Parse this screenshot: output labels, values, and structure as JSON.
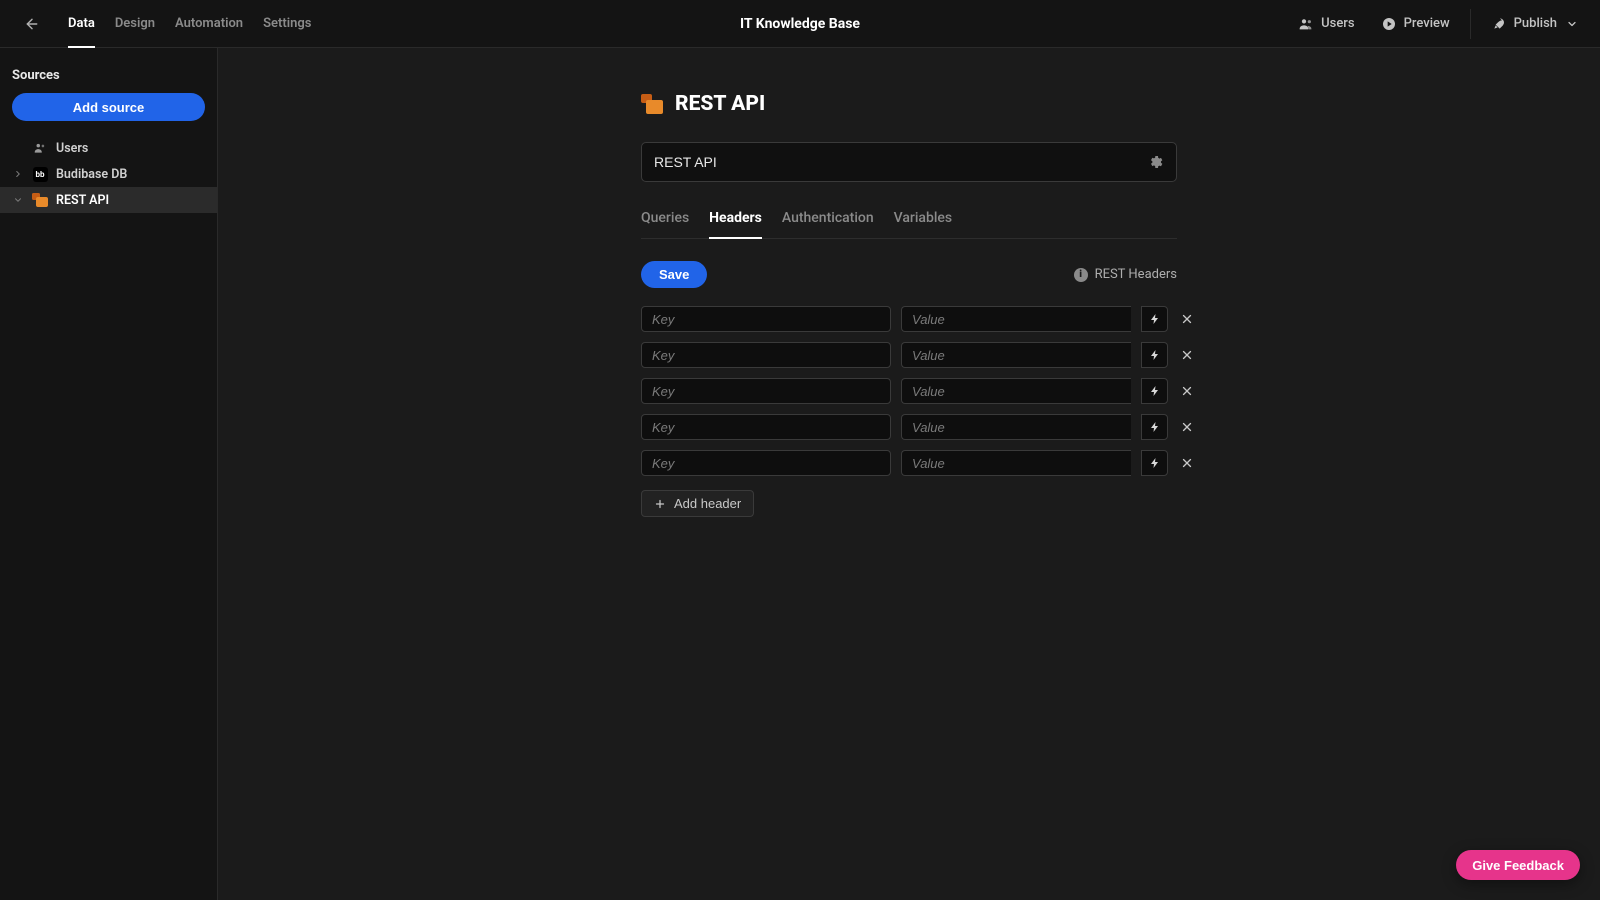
{
  "app_title": "IT Knowledge Base",
  "top_tabs": {
    "data": "Data",
    "design": "Design",
    "automation": "Automation",
    "settings": "Settings"
  },
  "top_actions": {
    "users": "Users",
    "preview": "Preview",
    "publish": "Publish"
  },
  "sidebar": {
    "heading": "Sources",
    "add_source": "Add source",
    "items": {
      "users": "Users",
      "budibase_db": "Budibase DB",
      "rest_api": "REST API"
    }
  },
  "main": {
    "title": "REST API",
    "name_value": "REST API",
    "sub_tabs": {
      "queries": "Queries",
      "headers": "Headers",
      "authentication": "Authentication",
      "variables": "Variables"
    },
    "save_label": "Save",
    "rest_headers_label": "REST Headers",
    "key_placeholder": "Key",
    "value_placeholder": "Value",
    "add_header_label": "Add header",
    "header_rows": [
      {
        "key": "",
        "value": ""
      },
      {
        "key": "",
        "value": ""
      },
      {
        "key": "",
        "value": ""
      },
      {
        "key": "",
        "value": ""
      },
      {
        "key": "",
        "value": ""
      }
    ]
  },
  "feedback_label": "Give Feedback"
}
